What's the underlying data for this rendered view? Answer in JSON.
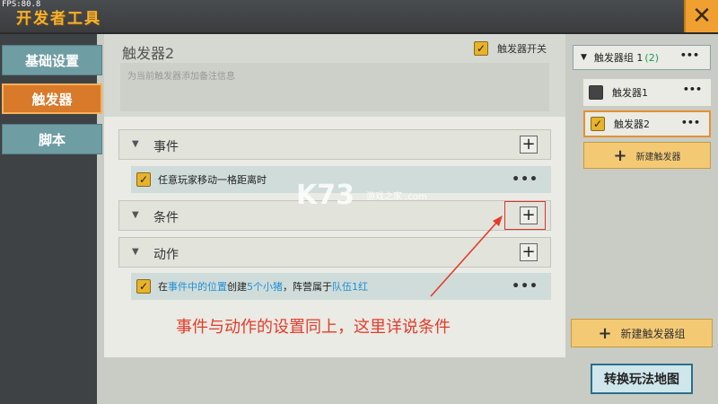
{
  "fps": "FPS:80.8",
  "app_title": "开发者工具",
  "close_icon": "✕",
  "sidebar": {
    "tabs": [
      {
        "label": "基础设置",
        "active": false
      },
      {
        "label": "触发器",
        "active": true
      },
      {
        "label": "脚本",
        "active": false
      }
    ]
  },
  "editor": {
    "trigger_name": "触发器2",
    "switch_label": "触发器开关",
    "switch_on": true,
    "note_placeholder": "为当前触发器添加备注信息",
    "sections": {
      "event": {
        "label": "事件"
      },
      "condition": {
        "label": "条件"
      },
      "action": {
        "label": "动作"
      }
    },
    "event_row": {
      "text": "任意玩家移动一格距离时"
    },
    "action_row": {
      "p1": "在",
      "p2": "事件中的位置",
      "p3": "创建",
      "p4": "5个",
      "p5": "小猪",
      "p6": "，阵营属于",
      "p7": "队伍1红"
    },
    "more": "•••"
  },
  "right_panel": {
    "group_name": "触发器组 1",
    "group_count": "(2)",
    "items": [
      {
        "name": "触发器1",
        "checked": false
      },
      {
        "name": "触发器2",
        "checked": true
      }
    ],
    "new_trigger": "新建触发器",
    "new_group": "新建触发器组"
  },
  "convert_button": "转换玩法地图",
  "annotation": "事件与动作的设置同上，这里详说条件",
  "watermark": "K73",
  "watermark_sub": "游戏之家 .com",
  "colors": {
    "accent_orange": "#d87a2a",
    "teal_tab": "#6e9da3",
    "annotation_red": "#e43b2c",
    "link_blue": "#1f8fd6"
  }
}
